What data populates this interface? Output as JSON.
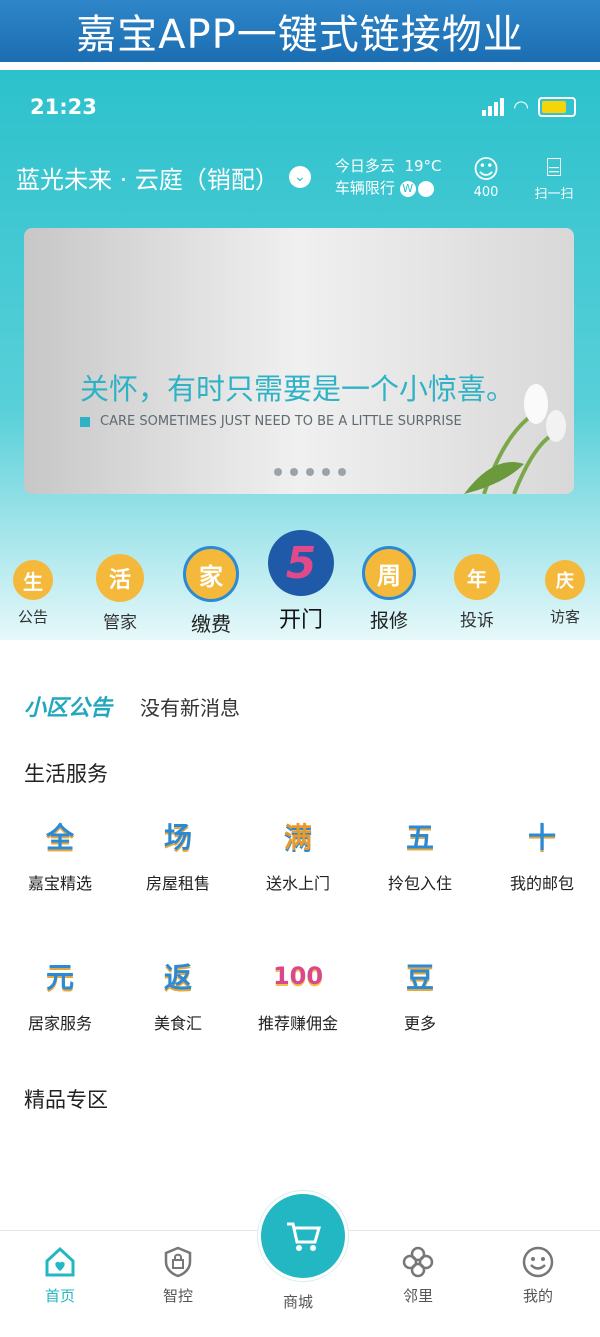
{
  "promo_banner": {
    "text": "嘉宝APP一键式链接物业"
  },
  "status_bar": {
    "time": "21:23"
  },
  "header": {
    "community": "蓝光未来 · 云庭（销配）",
    "weather": "今日多云",
    "temperature": "19°C",
    "traffic_limit_label": "车辆限行",
    "traffic_limit_value": "W",
    "service_button": "400",
    "scan_button": "扫一扫"
  },
  "carousel": {
    "title": "关怀，有时只需要是一个小惊喜。",
    "subtitle": "CARE SOMETIMES JUST NEED TO BE A LITTLE SURPRISE",
    "slides": 5
  },
  "quick_actions": [
    {
      "label": "公告",
      "glyph": "生"
    },
    {
      "label": "管家",
      "glyph": "活"
    },
    {
      "label": "缴费",
      "glyph": "家"
    },
    {
      "label": "开门",
      "glyph": "5"
    },
    {
      "label": "报修",
      "glyph": "周"
    },
    {
      "label": "投诉",
      "glyph": "年"
    },
    {
      "label": "访客",
      "glyph": "庆"
    }
  ],
  "notice": {
    "tag": "小区公告",
    "message": "没有新消息"
  },
  "life_services": {
    "heading": "生活服务",
    "items": [
      {
        "label": "嘉宝精选",
        "glyph": "全"
      },
      {
        "label": "房屋租售",
        "glyph": "场"
      },
      {
        "label": "送水上门",
        "glyph": "满"
      },
      {
        "label": "拎包入住",
        "glyph": "五"
      },
      {
        "label": "我的邮包",
        "glyph": "十"
      },
      {
        "label": "居家服务",
        "glyph": "元"
      },
      {
        "label": "美食汇",
        "glyph": "返"
      },
      {
        "label": "推荐赚佣金",
        "glyph": "100"
      },
      {
        "label": "更多",
        "glyph": "豆"
      }
    ]
  },
  "premium": {
    "heading": "精品专区"
  },
  "tabbar": {
    "home": "首页",
    "control": "智控",
    "mall": "商城",
    "neighbor": "邻里",
    "mine": "我的"
  },
  "colors": {
    "accent": "#23b7c4",
    "banner_blue": "#1b6db1"
  }
}
